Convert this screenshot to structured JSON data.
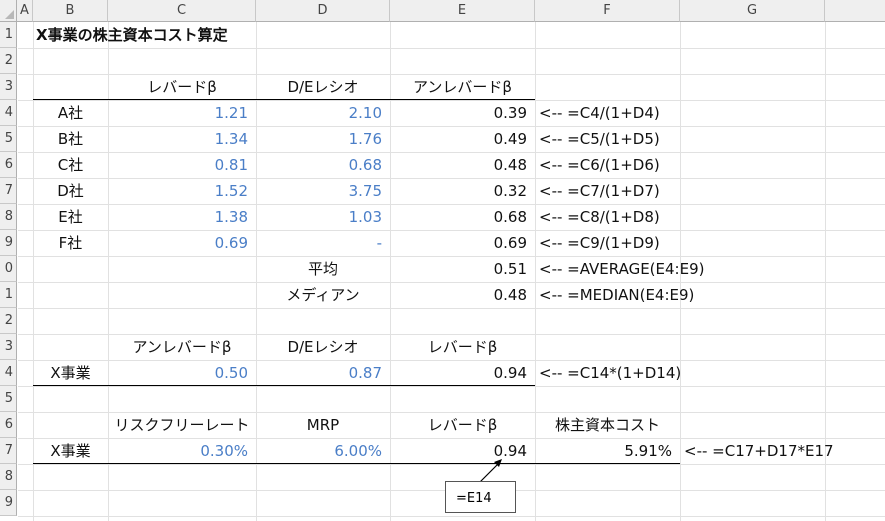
{
  "columns": [
    "A",
    "B",
    "C",
    "D",
    "E",
    "F",
    "G"
  ],
  "row_numbers": [
    "1",
    "2",
    "3",
    "4",
    "5",
    "6",
    "7",
    "8",
    "9",
    "0",
    "1",
    "2",
    "3",
    "4",
    "5",
    "6",
    "7",
    "8",
    "9"
  ],
  "title": "X事業の株主資本コスト算定",
  "table1": {
    "headers": [
      "レバードβ",
      "D/Eレシオ",
      "アンレバードβ"
    ],
    "rows": [
      {
        "label": "A社",
        "levered": "1.21",
        "de": "2.10",
        "unlevered": "0.39",
        "formula": "<-- =C4/(1+D4)"
      },
      {
        "label": "B社",
        "levered": "1.34",
        "de": "1.76",
        "unlevered": "0.49",
        "formula": "<-- =C5/(1+D5)"
      },
      {
        "label": "C社",
        "levered": "0.81",
        "de": "0.68",
        "unlevered": "0.48",
        "formula": "<-- =C6/(1+D6)"
      },
      {
        "label": "D社",
        "levered": "1.52",
        "de": "3.75",
        "unlevered": "0.32",
        "formula": "<-- =C7/(1+D7)"
      },
      {
        "label": "E社",
        "levered": "1.38",
        "de": "1.03",
        "unlevered": "0.68",
        "formula": "<-- =C8/(1+D8)"
      },
      {
        "label": "F社",
        "levered": "0.69",
        "de": "-",
        "unlevered": "0.69",
        "formula": "<-- =C9/(1+D9)"
      }
    ],
    "average": {
      "label": "平均",
      "value": "0.51",
      "formula": "<-- =AVERAGE(E4:E9)"
    },
    "median": {
      "label": "メディアン",
      "value": "0.48",
      "formula": "<-- =MEDIAN(E4:E9)"
    }
  },
  "table2": {
    "headers": [
      "アンレバードβ",
      "D/Eレシオ",
      "レバードβ"
    ],
    "label": "X事業",
    "unlevered": "0.50",
    "de": "0.87",
    "levered": "0.94",
    "formula": "<-- =C14*(1+D14)"
  },
  "table3": {
    "headers": [
      "リスクフリーレート",
      "MRP",
      "レバードβ",
      "株主資本コスト"
    ],
    "label": "X事業",
    "rf": "0.30%",
    "mrp": "6.00%",
    "beta": "0.94",
    "cost": "5.91%",
    "formula": "<-- =C17+D17*E17"
  },
  "callout": "=E14",
  "colors": {
    "input_blue": "#4a7ec7",
    "header_gray": "#efefef",
    "grid": "#e1e1e1"
  }
}
